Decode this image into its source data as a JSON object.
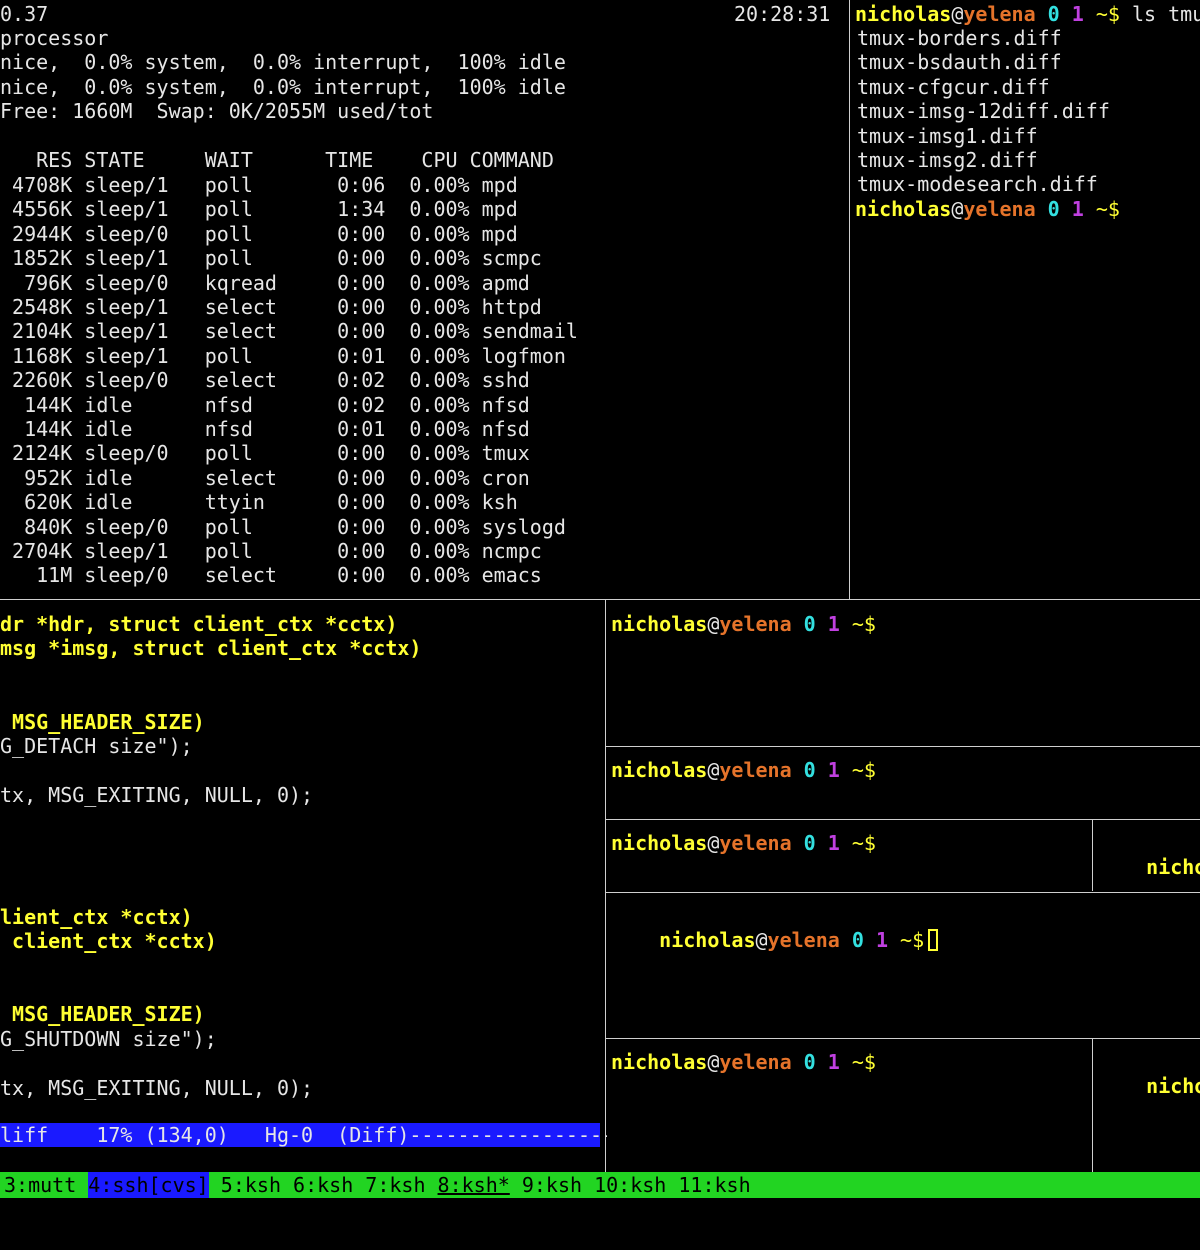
{
  "top_pane": {
    "load": "0.37",
    "clock": "20:28:31",
    "header_lines": [
      "processor",
      "nice,  0.0% system,  0.0% interrupt,  100% idle",
      "nice,  0.0% system,  0.0% interrupt,  100% idle",
      "Free: 1660M  Swap: 0K/2055M used/tot"
    ],
    "columns": "   RES STATE     WAIT      TIME    CPU COMMAND",
    "processes": [
      {
        "res": "4708K",
        "state": "sleep/1",
        "wait": "poll",
        "time": "0:06",
        "cpu": "0.00%",
        "command": "mpd"
      },
      {
        "res": "4556K",
        "state": "sleep/1",
        "wait": "poll",
        "time": "1:34",
        "cpu": "0.00%",
        "command": "mpd"
      },
      {
        "res": "2944K",
        "state": "sleep/0",
        "wait": "poll",
        "time": "0:00",
        "cpu": "0.00%",
        "command": "mpd"
      },
      {
        "res": "1852K",
        "state": "sleep/1",
        "wait": "poll",
        "time": "0:00",
        "cpu": "0.00%",
        "command": "scmpc"
      },
      {
        "res": "796K",
        "state": "sleep/0",
        "wait": "kqread",
        "time": "0:00",
        "cpu": "0.00%",
        "command": "apmd"
      },
      {
        "res": "2548K",
        "state": "sleep/1",
        "wait": "select",
        "time": "0:00",
        "cpu": "0.00%",
        "command": "httpd"
      },
      {
        "res": "2104K",
        "state": "sleep/1",
        "wait": "select",
        "time": "0:00",
        "cpu": "0.00%",
        "command": "sendmail"
      },
      {
        "res": "1168K",
        "state": "sleep/1",
        "wait": "poll",
        "time": "0:01",
        "cpu": "0.00%",
        "command": "logfmon"
      },
      {
        "res": "2260K",
        "state": "sleep/0",
        "wait": "select",
        "time": "0:02",
        "cpu": "0.00%",
        "command": "sshd"
      },
      {
        "res": "144K",
        "state": "idle",
        "wait": "nfsd",
        "time": "0:02",
        "cpu": "0.00%",
        "command": "nfsd"
      },
      {
        "res": "144K",
        "state": "idle",
        "wait": "nfsd",
        "time": "0:01",
        "cpu": "0.00%",
        "command": "nfsd"
      },
      {
        "res": "2124K",
        "state": "sleep/0",
        "wait": "poll",
        "time": "0:00",
        "cpu": "0.00%",
        "command": "tmux"
      },
      {
        "res": "952K",
        "state": "idle",
        "wait": "select",
        "time": "0:00",
        "cpu": "0.00%",
        "command": "cron"
      },
      {
        "res": "620K",
        "state": "idle",
        "wait": "ttyin",
        "time": "0:00",
        "cpu": "0.00%",
        "command": "ksh"
      },
      {
        "res": "840K",
        "state": "sleep/0",
        "wait": "poll",
        "time": "0:00",
        "cpu": "0.00%",
        "command": "syslogd"
      },
      {
        "res": "2704K",
        "state": "sleep/1",
        "wait": "poll",
        "time": "0:00",
        "cpu": "0.00%",
        "command": "ncmpc"
      },
      {
        "res": "11M",
        "state": "sleep/0",
        "wait": "select",
        "time": "0:00",
        "cpu": "0.00%",
        "command": "emacs"
      }
    ]
  },
  "prompt": {
    "user": "nicholas",
    "at": "@",
    "host": "yelena",
    "n0": "0",
    "n1": "1",
    "dir": "~$"
  },
  "ls_pane": {
    "command": "ls tmu",
    "files": [
      "tmux-borders.diff",
      "tmux-bsdauth.diff",
      "tmux-cfgcur.diff",
      "tmux-imsg-12diff.diff",
      "tmux-imsg1.diff",
      "tmux-imsg2.diff",
      "tmux-modesearch.diff"
    ]
  },
  "editor_pane": {
    "lines": [
      {
        "text": "dr *hdr, struct client_ctx *cctx)",
        "style": "yel"
      },
      {
        "text": "msg *imsg, struct client_ctx *cctx)",
        "style": "yel"
      },
      {
        "text": "",
        "style": "wht"
      },
      {
        "text": "",
        "style": "wht"
      },
      {
        "text": " MSG_HEADER_SIZE)",
        "style": "yel"
      },
      {
        "text": "G_DETACH size\");",
        "style": "wht"
      },
      {
        "text": "",
        "style": "wht"
      },
      {
        "text": "tx, MSG_EXITING, NULL, 0);",
        "style": "wht"
      },
      {
        "text": "",
        "style": "wht"
      },
      {
        "text": "",
        "style": "wht"
      },
      {
        "text": "",
        "style": "wht"
      },
      {
        "text": "",
        "style": "wht"
      },
      {
        "text": "lient_ctx *cctx)",
        "style": "yel"
      },
      {
        "text": " client_ctx *cctx)",
        "style": "yel"
      },
      {
        "text": "",
        "style": "wht"
      },
      {
        "text": "",
        "style": "wht"
      },
      {
        "text": " MSG_HEADER_SIZE)",
        "style": "yel"
      },
      {
        "text": "G_SHUTDOWN size\");",
        "style": "wht"
      },
      {
        "text": "",
        "style": "wht"
      },
      {
        "text": "tx, MSG_EXITING, NULL, 0);",
        "style": "wht"
      }
    ],
    "modeline": "liff    17% (134,0)   Hg-0  (Diff)-----------------"
  },
  "status_bar": {
    "windows": [
      {
        "label": "3:mutt",
        "state": "normal"
      },
      {
        "label": "4:ssh[cvs]",
        "state": "active"
      },
      {
        "label": "5:ksh",
        "state": "normal"
      },
      {
        "label": "6:ksh",
        "state": "normal"
      },
      {
        "label": "7:ksh",
        "state": "normal"
      },
      {
        "label": "8:ksh*",
        "state": "current"
      },
      {
        "label": "9:ksh",
        "state": "normal"
      },
      {
        "label": "10:ksh",
        "state": "normal"
      },
      {
        "label": "11:ksh",
        "state": "normal"
      }
    ]
  },
  "colors": {
    "user": "#ffff33",
    "host": "#e5732a",
    "n0": "#33e0e0",
    "n1": "#c040e0",
    "statusbar": "#22d422",
    "active_window": "#1a1aff"
  }
}
